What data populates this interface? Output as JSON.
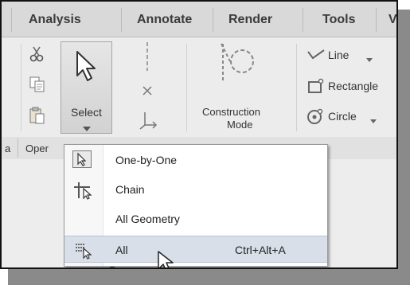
{
  "tabs": [
    "Analysis",
    "Annotate",
    "Render",
    "Tools",
    "V"
  ],
  "ribbon": {
    "select_label": "Select",
    "construction_label_1": "Construction",
    "construction_label_2": "Mode",
    "sketch_items": [
      "Line",
      "Rectangle",
      "Circle"
    ],
    "group_labels": [
      "a",
      "Oper"
    ]
  },
  "menu": {
    "items": [
      {
        "label": "One-by-One",
        "shortcut": ""
      },
      {
        "label": "Chain",
        "shortcut": ""
      },
      {
        "label": "All Geometry",
        "shortcut": ""
      },
      {
        "label": "All",
        "shortcut": "Ctrl+Alt+A"
      }
    ]
  }
}
